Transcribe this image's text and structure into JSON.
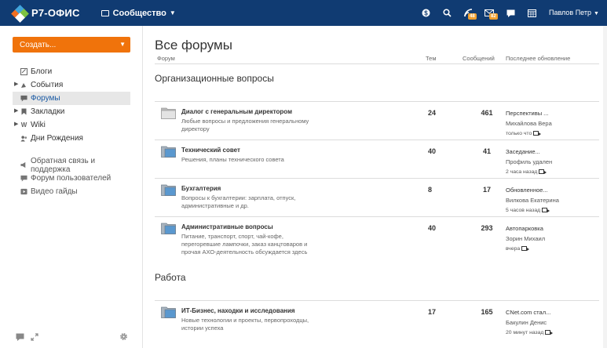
{
  "app": {
    "logo_text": "Р7-ОФИС",
    "module_label": "Сообщество",
    "user_name": "Павлов Петр",
    "brand_color": "#103b72",
    "accent_color": "#f0730b",
    "badges": {
      "feed": "48",
      "mail": "82"
    }
  },
  "sidebar": {
    "create_label": "Создать...",
    "items": [
      {
        "label": "Блоги",
        "icon": "blog-icon",
        "expandable": false
      },
      {
        "label": "События",
        "icon": "events-icon",
        "expandable": true
      },
      {
        "label": "Форумы",
        "icon": "forums-icon",
        "expandable": false,
        "active": true
      },
      {
        "label": "Закладки",
        "icon": "bookmarks-icon",
        "expandable": true
      },
      {
        "label": "Wiki",
        "icon": "wiki-icon",
        "expandable": true
      },
      {
        "label": "Дни Рождения",
        "icon": "birthdays-icon",
        "expandable": false
      }
    ],
    "extra_items": [
      {
        "label": "Обратная связь и поддержка",
        "icon": "feedback-icon"
      },
      {
        "label": "Форум пользователей",
        "icon": "user-forum-icon"
      },
      {
        "label": "Видео гайды",
        "icon": "video-icon"
      }
    ]
  },
  "main": {
    "title": "Все форумы",
    "columns": {
      "forum": "Форум",
      "topics": "Тем",
      "posts": "Сообщений",
      "last_update": "Последнее обновление"
    },
    "categories": [
      {
        "title": "Организационные вопросы",
        "forums": [
          {
            "name": "Диалог с генеральным директором",
            "description": "Любые вопросы и предложения генеральному директору",
            "topics": "24",
            "posts": "461",
            "last_topic": "Перспективы ...",
            "last_author": "Михайлова Вера",
            "last_time": "только что",
            "folder_style": "gray"
          },
          {
            "name": "Технический совет",
            "description": "Решения, планы технического совета",
            "topics": "40",
            "posts": "41",
            "last_topic": "Заседание...",
            "last_author": "Профиль удален",
            "last_time": "2 часа назад",
            "folder_style": "blue"
          },
          {
            "name": "Бухгалтерия",
            "description": "Вопросы к бухгалтерии: зарплата, отпуск, административные и др.",
            "topics": "8",
            "posts": "17",
            "last_topic": "Обновленное...",
            "last_author": "Вилкова Екатерина",
            "last_time": "5 часов назад",
            "folder_style": "blue"
          },
          {
            "name": "Административные вопросы",
            "description": "Питание, транспорт, спорт, чай-кофе, перегоревшие лампочки, заказ канцтоваров и прочая АХО-деятельность обсуждается здесь",
            "topics": "40",
            "posts": "293",
            "last_topic": "Автопарковка",
            "last_author": "Зорин Михаил",
            "last_time": "вчера",
            "folder_style": "blue"
          }
        ]
      },
      {
        "title": "Работа",
        "forums": [
          {
            "name": "ИТ-Бизнес, находки и исследования",
            "description": "Новые технологии и проекты, первопроходцы, истории успеха",
            "topics": "17",
            "posts": "165",
            "last_topic": "CNet.com стал...",
            "last_author": "Бакулин Денис",
            "last_time": "20 минут назад",
            "folder_style": "blue"
          }
        ]
      }
    ]
  }
}
